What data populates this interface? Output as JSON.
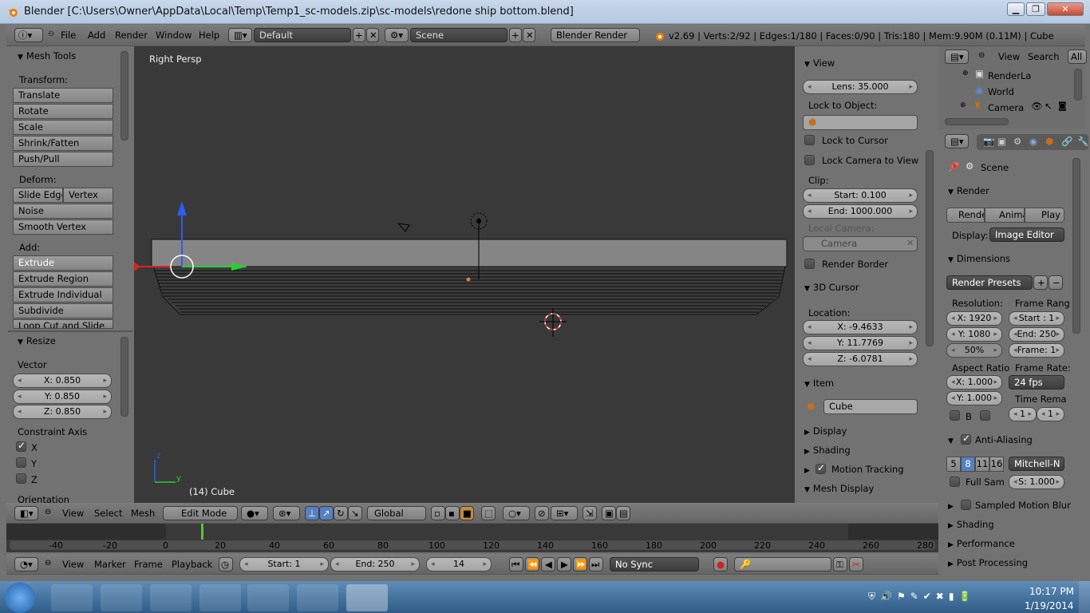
{
  "window": {
    "title": "Blender [C:\\Users\\Owner\\AppData\\Local\\Temp\\Temp1_sc-models.zip\\sc-models\\redone ship bottom.blend]"
  },
  "header": {
    "menus": [
      "File",
      "Add",
      "Render",
      "Window",
      "Help"
    ],
    "layout": "Default",
    "scene": "Scene",
    "engine": "Blender Render",
    "info": "v2.69 | Verts:2/92 | Edges:1/180 | Faces:0/90 | Tris:180 | Mem:9.90M (0.11M) | Cube"
  },
  "toolshelf": {
    "title": "Mesh Tools",
    "transform_label": "Transform:",
    "transform": [
      "Translate",
      "Rotate",
      "Scale",
      "Shrink/Fatten",
      "Push/Pull"
    ],
    "deform_label": "Deform:",
    "slide_edge": "Slide Edge",
    "vertex": "Vertex",
    "noise": "Noise",
    "smooth_vertex": "Smooth Vertex",
    "add_label": "Add:",
    "extrude": "Extrude",
    "add": [
      "Extrude Region",
      "Extrude Individual",
      "Subdivide",
      "Loop Cut and Slide"
    ]
  },
  "resize": {
    "title": "Resize",
    "vector_label": "Vector",
    "x": "X: 0.850",
    "y": "Y: 0.850",
    "z": "Z: 0.850",
    "constraint_label": "Constraint Axis",
    "cx": "X",
    "cy": "Y",
    "cz": "Z",
    "orientation_label": "Orientation"
  },
  "viewport": {
    "persp": "Right Persp",
    "object": "(14) Cube",
    "axis_z": "z",
    "axis_y": "y"
  },
  "props": {
    "view_title": "View",
    "lens": "Lens: 35.000",
    "lock_object": "Lock to Object:",
    "lock_cursor": "Lock to Cursor",
    "lock_camera": "Lock Camera to View",
    "clip": "Clip:",
    "clip_start": "Start: 0.100",
    "clip_end": "End: 1000.000",
    "local_camera": "Local Camera:",
    "camera": "Camera",
    "render_border": "Render Border",
    "cursor_title": "3D Cursor",
    "location": "Location:",
    "cx": "X: -9.4633",
    "cy": "Y: 11.7769",
    "cz": "Z: -6.0781",
    "item_title": "Item",
    "item_name": "Cube",
    "display": "Display",
    "shading": "Shading",
    "motion_tracking": "Motion Tracking",
    "mesh_display": "Mesh Display"
  },
  "outliner": {
    "view": "View",
    "search": "Search",
    "all": "All",
    "items": [
      "RenderLa",
      "World",
      "Camera"
    ]
  },
  "render": {
    "scene": "Scene",
    "render_title": "Render",
    "render_btn": "Render",
    "anim_btn": "Anima",
    "play_btn": "Play",
    "display_label": "Display:",
    "display_val": "Image Editor",
    "dimensions_title": "Dimensions",
    "presets": "Render Presets",
    "resolution": "Resolution:",
    "frame_range": "Frame Rang",
    "res_x": "X: 1920",
    "res_y": "Y: 1080",
    "res_pct": "50%",
    "start": "Start : 1",
    "end": "End: 250",
    "frame": "Frame: 1",
    "aspect": "Aspect Ratio",
    "frame_rate": "Frame Rate:",
    "asp_x": "X: 1.000",
    "asp_y": "Y: 1.000",
    "fps": "24 fps",
    "time_remap": "Time Rema",
    "b": "B",
    "remap_old": "1",
    "remap_new": "1",
    "aa_title": "Anti-Aliasing",
    "aa": [
      "5",
      "8",
      "11",
      "16"
    ],
    "filter": "Mitchell-N",
    "full_sample": "Full Sam",
    "size": "S: 1.000",
    "smb": "Sampled Motion Blur",
    "shading": "Shading",
    "performance": "Performance",
    "post": "Post Processing"
  },
  "view3d_header": {
    "menus": [
      "View",
      "Select",
      "Mesh"
    ],
    "mode": "Edit Mode",
    "orientation": "Global"
  },
  "timeline": {
    "ticks": [
      "-40",
      "-20",
      "0",
      "20",
      "40",
      "60",
      "80",
      "100",
      "120",
      "140",
      "160",
      "180",
      "200",
      "220",
      "240",
      "260",
      "280"
    ],
    "menus": [
      "View",
      "Marker",
      "Frame",
      "Playback"
    ],
    "start": "Start: 1",
    "end": "End: 250",
    "current": "14",
    "sync": "No Sync"
  },
  "taskbar": {
    "time": "10:17 PM",
    "date": "1/19/2014"
  }
}
